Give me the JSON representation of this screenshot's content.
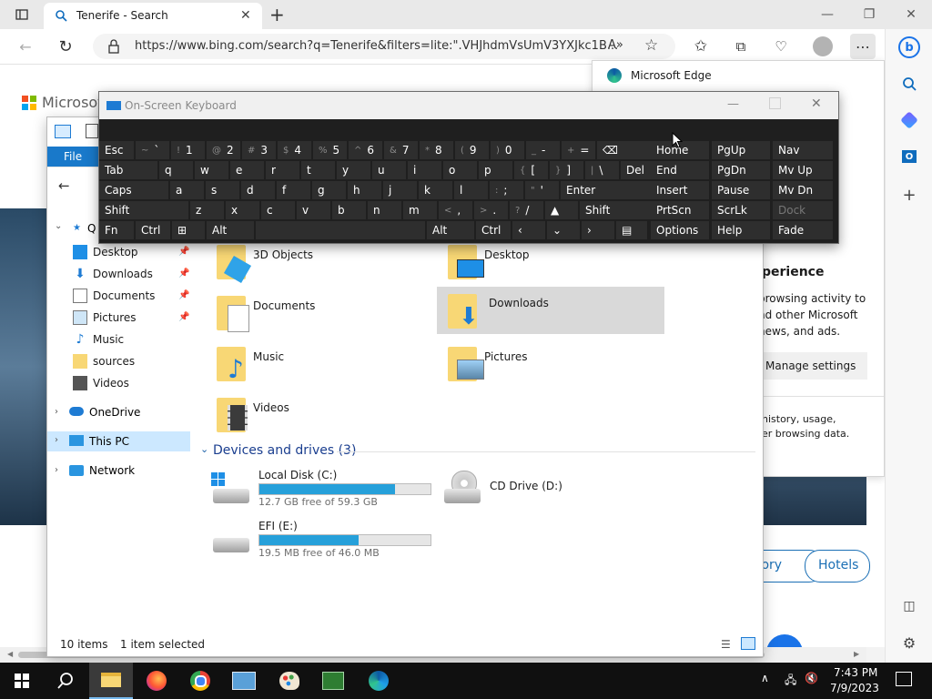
{
  "browser": {
    "tab_title": "Tenerife - Search",
    "url": "https://www.bing.com/search?q=Tenerife&filters=lite:\".VHJhdmVsUmV3YXJkc1B...",
    "popup_title": "Microsoft Edge",
    "bing_logo_text": "Microsoft",
    "privacy": {
      "heading": "perience",
      "body": "browsing activity to\nnd other Microsoft\n news, and ads.",
      "manage_button": "Manage settings",
      "footer": "history, usage,\ner browsing data."
    },
    "chips": [
      "tory",
      "Hotels"
    ]
  },
  "explorer": {
    "ribbon_file": "File",
    "nav": {
      "quick_access": "Q",
      "items": [
        "Desktop",
        "Downloads",
        "Documents",
        "Pictures",
        "Music",
        "sources",
        "Videos"
      ],
      "onedrive": "OneDrive",
      "this_pc": "This PC",
      "network": "Network"
    },
    "folders": [
      "3D Objects",
      "Desktop",
      "Documents",
      "Downloads",
      "Music",
      "Pictures",
      "Videos"
    ],
    "devices_header": "Devices and drives (3)",
    "drives": [
      {
        "name": "Local Disk (C:)",
        "free": "12.7 GB free of 59.3 GB",
        "used_fraction": 0.79
      },
      {
        "name": "CD Drive (D:)"
      },
      {
        "name": "EFI (E:)",
        "free": "19.5 MB free of 46.0 MB",
        "used_fraction": 0.58
      }
    ],
    "status": {
      "items": "10 items",
      "selected": "1 item selected"
    }
  },
  "osk": {
    "title": "On-Screen Keyboard",
    "rows": [
      [
        {
          "l": "Esc"
        },
        {
          "s": "~",
          "l": "`"
        },
        {
          "s": "!",
          "l": "1"
        },
        {
          "s": "@",
          "l": "2"
        },
        {
          "s": "#",
          "l": "3"
        },
        {
          "s": "$",
          "l": "4"
        },
        {
          "s": "%",
          "l": "5"
        },
        {
          "s": "^",
          "l": "6"
        },
        {
          "s": "&",
          "l": "7"
        },
        {
          "s": "*",
          "l": "8"
        },
        {
          "s": "(",
          "l": "9"
        },
        {
          "s": ")",
          "l": "0"
        },
        {
          "s": "_",
          "l": "-"
        },
        {
          "s": "+",
          "l": "="
        },
        {
          "l": "⌫"
        }
      ],
      [
        {
          "l": "Tab"
        },
        {
          "l": "q"
        },
        {
          "l": "w"
        },
        {
          "l": "e"
        },
        {
          "l": "r"
        },
        {
          "l": "t"
        },
        {
          "l": "y"
        },
        {
          "l": "u"
        },
        {
          "l": "i"
        },
        {
          "l": "o"
        },
        {
          "l": "p"
        },
        {
          "s": "{",
          "l": "["
        },
        {
          "s": "}",
          "l": "]"
        },
        {
          "s": "|",
          "l": "\\"
        },
        {
          "l": "Del"
        }
      ],
      [
        {
          "l": "Caps"
        },
        {
          "l": "a"
        },
        {
          "l": "s"
        },
        {
          "l": "d"
        },
        {
          "l": "f"
        },
        {
          "l": "g"
        },
        {
          "l": "h"
        },
        {
          "l": "j"
        },
        {
          "l": "k"
        },
        {
          "l": "l"
        },
        {
          "s": ":",
          "l": ";"
        },
        {
          "s": "\"",
          "l": "'"
        },
        {
          "l": "Enter"
        }
      ],
      [
        {
          "l": "Shift"
        },
        {
          "l": "z"
        },
        {
          "l": "x"
        },
        {
          "l": "c"
        },
        {
          "l": "v"
        },
        {
          "l": "b"
        },
        {
          "l": "n"
        },
        {
          "l": "m"
        },
        {
          "s": "<",
          "l": ","
        },
        {
          "s": ">",
          "l": "."
        },
        {
          "s": "?",
          "l": "/"
        },
        {
          "l": "▲"
        },
        {
          "l": "Shift"
        }
      ],
      [
        {
          "l": "Fn"
        },
        {
          "l": "Ctrl"
        },
        {
          "l": "⊞"
        },
        {
          "l": "Alt"
        },
        {
          "l": ""
        },
        {
          "l": "Alt"
        },
        {
          "l": "Ctrl"
        },
        {
          "l": "‹"
        },
        {
          "l": "⌄"
        },
        {
          "l": "›"
        },
        {
          "l": "▤"
        }
      ]
    ],
    "nav_keys": [
      [
        "Home",
        "PgUp",
        "Nav"
      ],
      [
        "End",
        "PgDn",
        "Mv Up"
      ],
      [
        "Insert",
        "Pause",
        "Mv Dn"
      ],
      [
        "PrtScn",
        "ScrLk",
        "Dock"
      ],
      [
        "Options",
        "Help",
        "Fade"
      ]
    ]
  },
  "taskbar": {
    "time": "7:43 PM",
    "date": "7/9/2023"
  }
}
